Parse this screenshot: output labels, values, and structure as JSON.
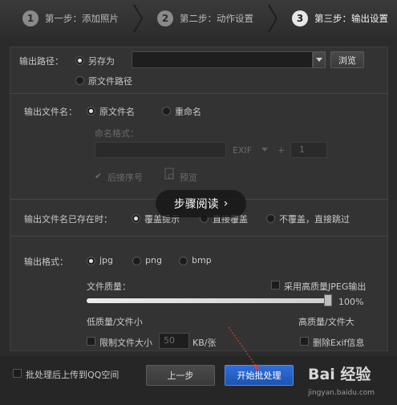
{
  "steps": [
    {
      "num": "1",
      "label": "第一步：添加照片"
    },
    {
      "num": "2",
      "label": "第二步：动作设置"
    },
    {
      "num": "3",
      "label": "第三步：输出设置"
    }
  ],
  "output_path": {
    "label": "输出路径：",
    "opt_save_as": "另存为",
    "opt_original": "原文件路径",
    "path_value": "",
    "browse": "浏览"
  },
  "output_name": {
    "label": "输出文件名：",
    "opt_original": "原文件名",
    "opt_rename": "重命名",
    "name_format_label": "命名格式：",
    "ext_value": "EXIF",
    "num_value": "1",
    "seq_label": "后接序号",
    "preview": "预览"
  },
  "exists": {
    "label": "输出文件名已存在时：",
    "opt_overwrite_prompt": "覆盖提示",
    "opt_overwrite": "直接覆盖",
    "opt_skip": "不覆盖，直接跳过"
  },
  "format": {
    "label": "输出格式：",
    "opt_jpg": "jpg",
    "opt_png": "png",
    "opt_bmp": "bmp",
    "quality_label": "文件质量：",
    "high_quality_jpeg": "采用高质量JPEG输出",
    "quality_value": "100%",
    "quality_fraction": 1.0,
    "low_label": "低质量/文件小",
    "high_label": "高质量/文件大",
    "limit_size_label": "限制文件大小",
    "limit_size_value": "50",
    "limit_unit": "KB/张",
    "remove_exif": "删除Exif信息"
  },
  "overlay": {
    "text": "步骤阅读",
    "chevron": "›"
  },
  "footer": {
    "upload_qq": "批处理后上传到QQ空间",
    "prev": "上一步",
    "start": "开始批处理",
    "watermark": "Bai 经验",
    "watermark_url": "jingyan.baidu.com"
  },
  "colors": {
    "bg": "#2b2b2b",
    "panel": "#333333",
    "primary": "#2f6fd9",
    "arrow": "#e03a3a"
  }
}
